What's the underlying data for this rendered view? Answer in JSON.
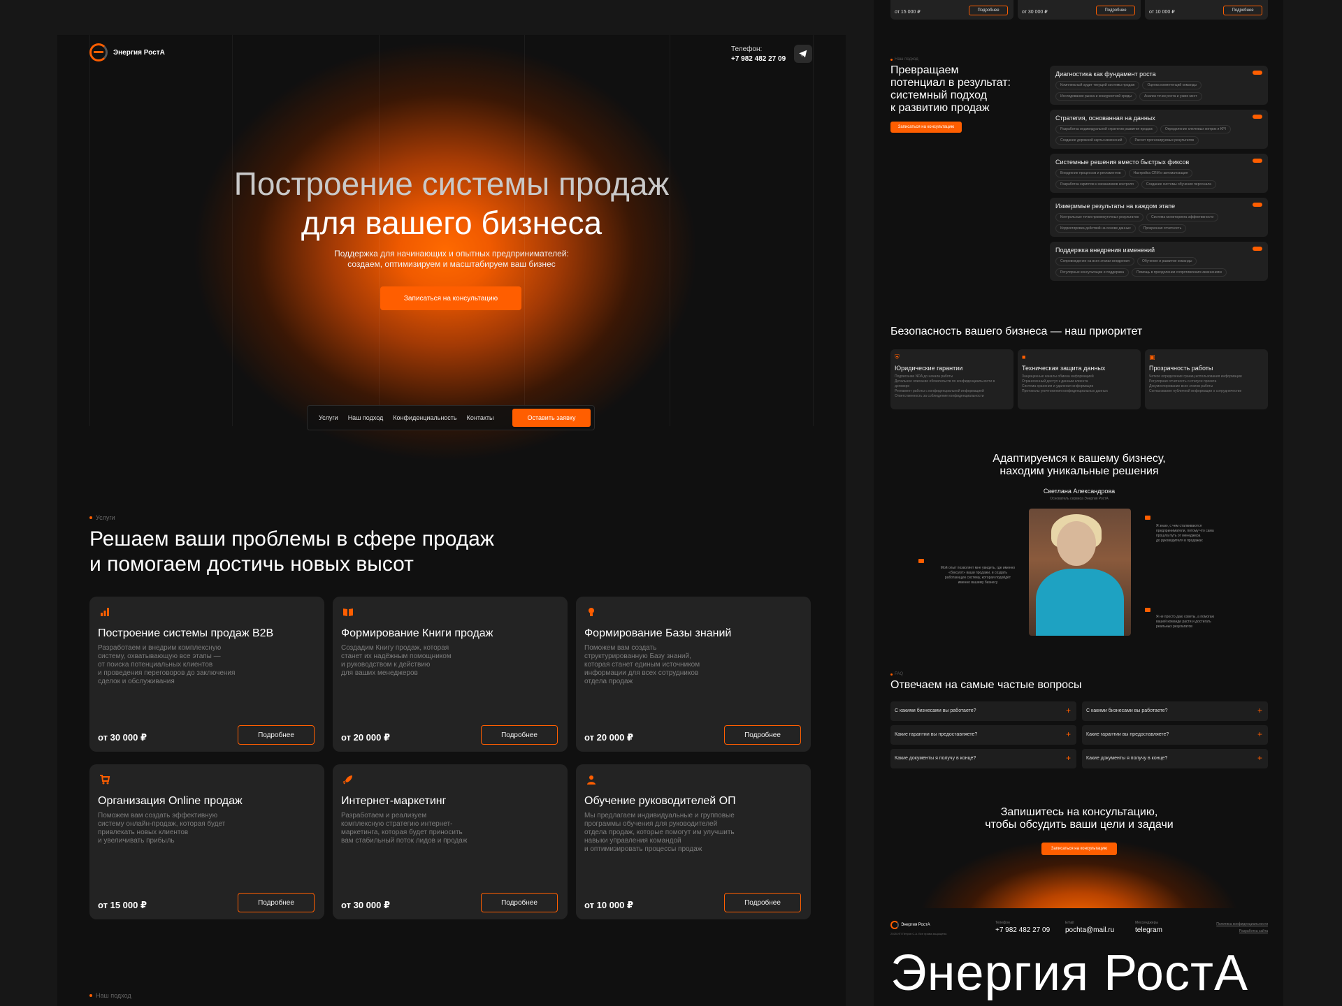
{
  "colors": {
    "accent": "#ff5e00",
    "bg": "#101010",
    "card": "#232323"
  },
  "brand": {
    "name": "Энергия РостА",
    "logo_icon": "energy-logo-icon"
  },
  "header": {
    "phone_label": "Телефон:",
    "phone": "+7 982 482 27 09",
    "telegram_icon": "telegram-icon"
  },
  "hero": {
    "title_line1": "Построение системы продаж",
    "title_line2": "для вашего бизнеса",
    "subtitle": "Поддержка для начинающих и опытных предпринимателей:\nсоздаем, оптимизируем и масштабируем ваш бизнес",
    "cta": "Записаться на консультацию"
  },
  "nav": {
    "items": [
      "Услуги",
      "Наш подход",
      "Конфиденциальность",
      "Контакты"
    ],
    "cta": "Оставить заявку"
  },
  "services": {
    "tag": "Услуги",
    "title_line1": "Решаем ваши проблемы в сфере продаж",
    "title_line2": "и помогаем достичь новых высот",
    "cards": [
      {
        "icon": "bar-chart-icon",
        "title": "Построение системы продаж B2B",
        "desc": "Разработаем и внедрим комплексную\nсистему, охватывающую все этапы —\nот поиска потенциальных клиентов\nи проведения переговоров до заключения\nсделок и обслуживания",
        "price": "от 30 000 ₽",
        "button": "Подробнее"
      },
      {
        "icon": "book-icon",
        "title": "Формирование Книги продаж",
        "desc": "Создадим Книгу продаж, которая\nстанет их надёжным помощником\nи руководством к действию\nдля ваших менеджеров",
        "price": "от 20 000 ₽",
        "button": "Подробнее"
      },
      {
        "icon": "lightbulb-icon",
        "title": "Формирование Базы знаний",
        "desc": "Поможем вам создать\nструктурированную Базу знаний,\nкоторая станет единым источником\nинформации для всех сотрудников\nотдела продаж",
        "price": "от 20 000 ₽",
        "button": "Подробнее"
      },
      {
        "icon": "cart-icon",
        "title": "Организация Online продаж",
        "desc": "Поможем вам создать эффективную\nсистему онлайн-продаж, которая будет\nпривлекать новых клиентов\nи увеличивать прибыль",
        "price": "от 15 000 ₽",
        "button": "Подробнее"
      },
      {
        "icon": "rocket-icon",
        "title": "Интернет-маркетинг",
        "desc": "Разработаем и реализуем\nкомплексную стратегию интернет-\nмаркетинга, которая будет приносить\nвам стабильный поток лидов и продаж",
        "price": "от 30 000 ₽",
        "button": "Подробнее"
      },
      {
        "icon": "person-icon",
        "title": "Обучение руководителей ОП",
        "desc": "Мы предлагаем индивидуальные и групповые\nпрограммы обучения для руководителей\nотдела продаж, которые помогут им улучшить\nнавыки управления командой\nи оптимизировать процессы продаж",
        "price": "от 10 000 ₽",
        "button": "Подробнее"
      }
    ]
  },
  "approach_tag": "Наш подход",
  "right": {
    "top_cards": [
      {
        "price": "от 15 000 ₽",
        "button": "Подробнее"
      },
      {
        "price": "от 30 000 ₽",
        "button": "Подробнее"
      },
      {
        "price": "от 10 000 ₽",
        "button": "Подробнее"
      }
    ],
    "approach": {
      "title": "Превращаем\nпотенциал в результат:\nсистемный подход\nк развитию продаж",
      "button": "Записаться на консультацию",
      "items": [
        {
          "title": "Диагностика как фундамент роста",
          "tags": [
            "Комплексный аудит текущей системы продаж",
            "Оценка компетенций команды",
            "Исследование рынка и конкурентной среды",
            "Анализ точек роста и узких мест"
          ]
        },
        {
          "title": "Стратегия, основанная на данных",
          "tags": [
            "Разработка индивидуальной стратегии развития продаж",
            "Определение ключевых метрик и KPI",
            "Создание дорожной карты изменений",
            "Расчет прогнозируемых результатов"
          ]
        },
        {
          "title": "Системные решения вместо быстрых фиксов",
          "tags": [
            "Внедрение процессов и регламентов",
            "Настройка CRM и автоматизация",
            "Разработка скриптов и механизмов контроля",
            "Создание системы обучения персонала"
          ]
        },
        {
          "title": "Измеримые результаты на каждом этапе",
          "tags": [
            "Контрольные точки промежуточных результатов",
            "Система мониторинга эффективности",
            "Корректировка действий на основе данных",
            "Прозрачная отчетность"
          ]
        },
        {
          "title": "Поддержка внедрения изменений",
          "tags": [
            "Сопровождение на всех этапах внедрения",
            "Обучение и развитие команды",
            "Регулярные консультации и поддержка",
            "Помощь в преодолении сопротивления изменениям"
          ]
        }
      ]
    },
    "security": {
      "title": "Безопасность вашего бизнеса — наш приоритет",
      "cards": [
        {
          "icon": "shield-icon",
          "title": "Юридические гарантии",
          "items": [
            "Подписание NDA до начала работы",
            "Детальное описание обязательств по конфиденциальности в договоре",
            "Регламент работы с конфиденциальной информацией",
            "Ответственность за соблюдение конфиденциальности"
          ]
        },
        {
          "icon": "lock-icon",
          "title": "Техническая защита данных",
          "items": [
            "Защищенные каналы обмена информацией",
            "Ограниченный доступ к данным клиента",
            "Система хранения и удаления информации",
            "Протоколы уничтожения конфиденциальных данных"
          ]
        },
        {
          "icon": "transparency-icon",
          "title": "Прозрачность работы",
          "items": [
            "Четкое определение границ использования информации",
            "Регулярная отчетность о статусе проекта",
            "Документирование всех этапов работы",
            "Согласование публичной информации о сотрудничестве"
          ]
        }
      ]
    },
    "adapt": {
      "title": "Адаптируемся к вашему бизнесу,\nнаходим уникальные решения",
      "name": "Светлана Александрова",
      "role": "Основатель сервиса Энергия РостА",
      "quote1": "Я знаю, с чем сталкиваются\nпредприниматели, потому что сама\nпрошла путь от менеджера\nдо руководителя в продажах",
      "quote2": "Мой опыт позволяет мне увидеть, где именно\n«буксуют» ваши продажи, и создать\nработающую систему, которая подойдёт\nименно вашему бизнесу",
      "quote3": "Я не просто даю советы, а помогаю\nвашей команде расти и достигать\nреальных результатов"
    },
    "faq": {
      "tag": "FAQ",
      "title": "Отвечаем на самые частые вопросы",
      "items": [
        "С какими бизнесами вы работаете?",
        "С какими бизнесами вы работаете?",
        "Какие гарантии вы предоставляете?",
        "Какие гарантии вы предоставляете?",
        "Какие документы я получу в конце?",
        "Какие документы я получу в конце?"
      ]
    },
    "cta": {
      "title": "Запишитесь на консультацию,\nчтобы обсудить ваши цели и задачи",
      "button": "Записаться на консультацию"
    },
    "footer": {
      "brand": "Энергия РостА",
      "copyright": "2025 ИП Петров С.А. Все права защищены",
      "phone_label": "Телефон",
      "phone": "+7 982 482 27 09",
      "email_label": "Email",
      "email": "pochta@mail.ru",
      "messenger_label": "Мессенджеры",
      "messenger": "telegram",
      "link1": "Политика конфиденциальности",
      "link2": "Разработка сайта"
    },
    "big_brand": "Энергия РостА"
  }
}
